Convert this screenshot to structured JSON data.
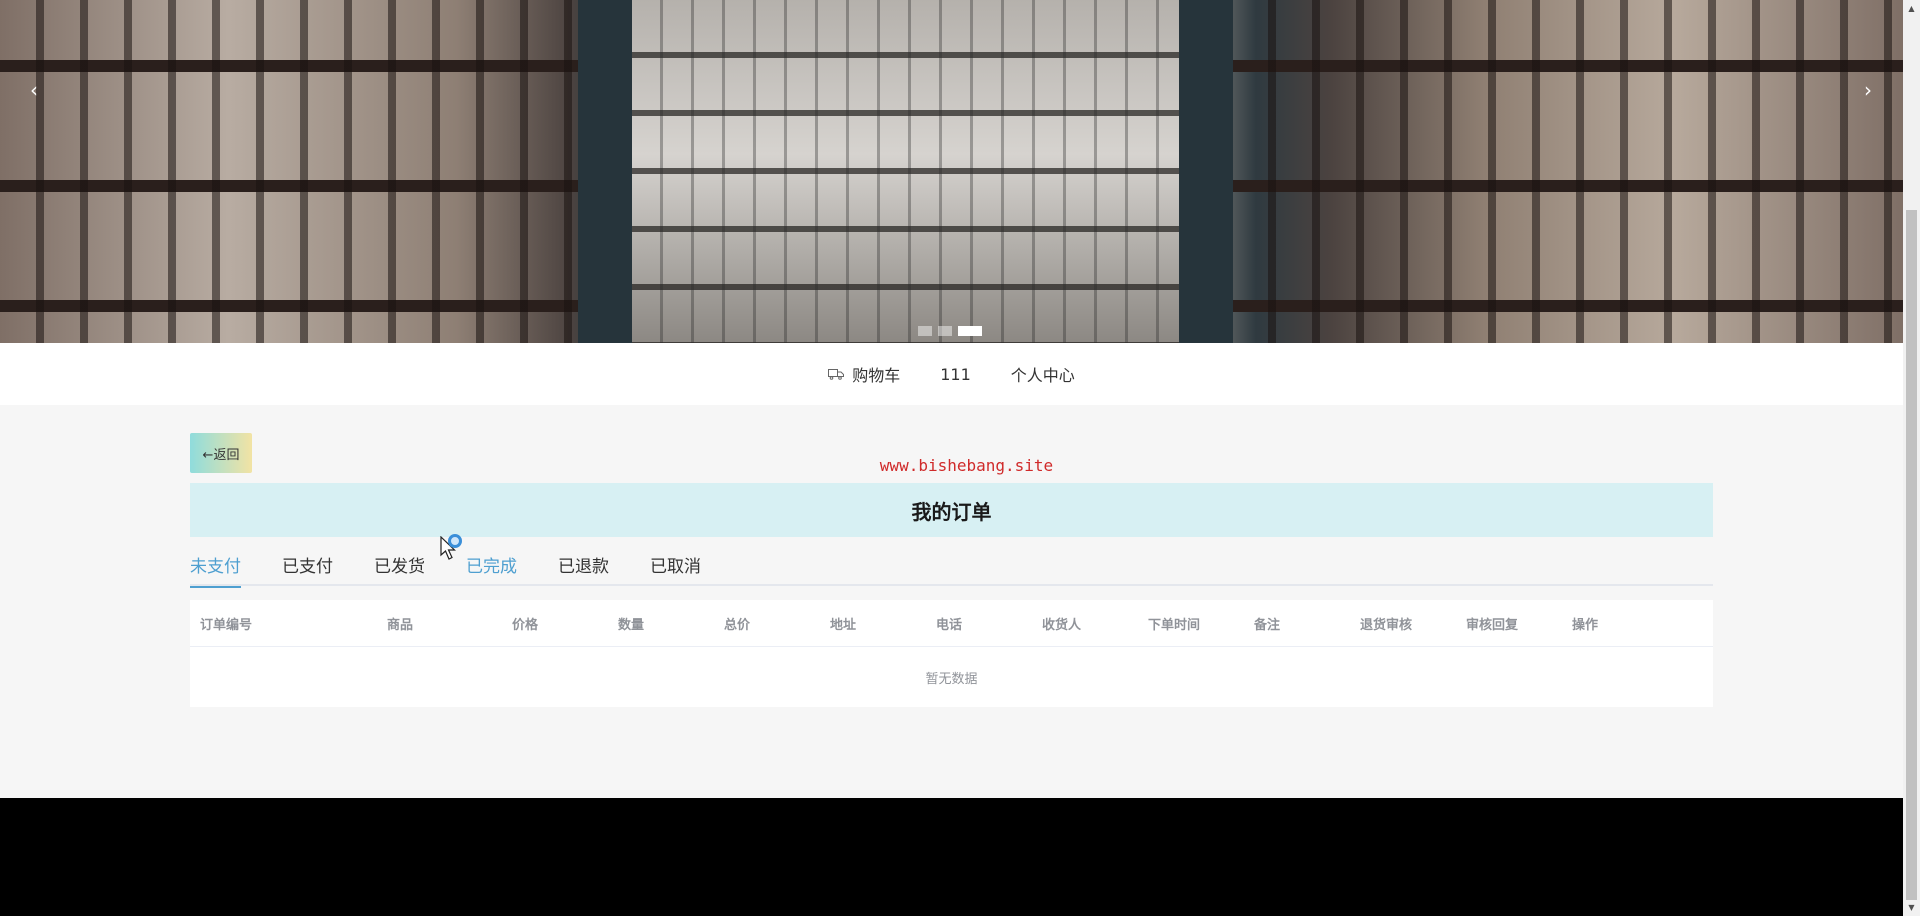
{
  "banner": {
    "prev_label": "‹",
    "next_label": "›",
    "slides_count": 3,
    "active_slide": 3
  },
  "nav": {
    "cart_icon": "truck-icon",
    "cart_label": "购物车",
    "user_label": "111",
    "profile_label": "个人中心"
  },
  "page": {
    "back_label": "←返回",
    "watermark": "www.bishebang.site",
    "title": "我的订单"
  },
  "tabs": [
    {
      "label": "未支付",
      "state": "active"
    },
    {
      "label": "已支付",
      "state": "normal"
    },
    {
      "label": "已发货",
      "state": "normal"
    },
    {
      "label": "已完成",
      "state": "hover"
    },
    {
      "label": "已退款",
      "state": "normal"
    },
    {
      "label": "已取消",
      "state": "normal"
    }
  ],
  "table": {
    "columns": [
      "订单编号",
      "商品",
      "价格",
      "数量",
      "总价",
      "地址",
      "电话",
      "收货人",
      "下单时间",
      "备注",
      "退货审核",
      "审核回复",
      "操作"
    ],
    "empty_text": "暂无数据"
  },
  "colors": {
    "accent": "#4e9fd0",
    "title_bg": "#d7f0f3",
    "watermark": "#d02a2a",
    "footer_bg": "#000000"
  }
}
